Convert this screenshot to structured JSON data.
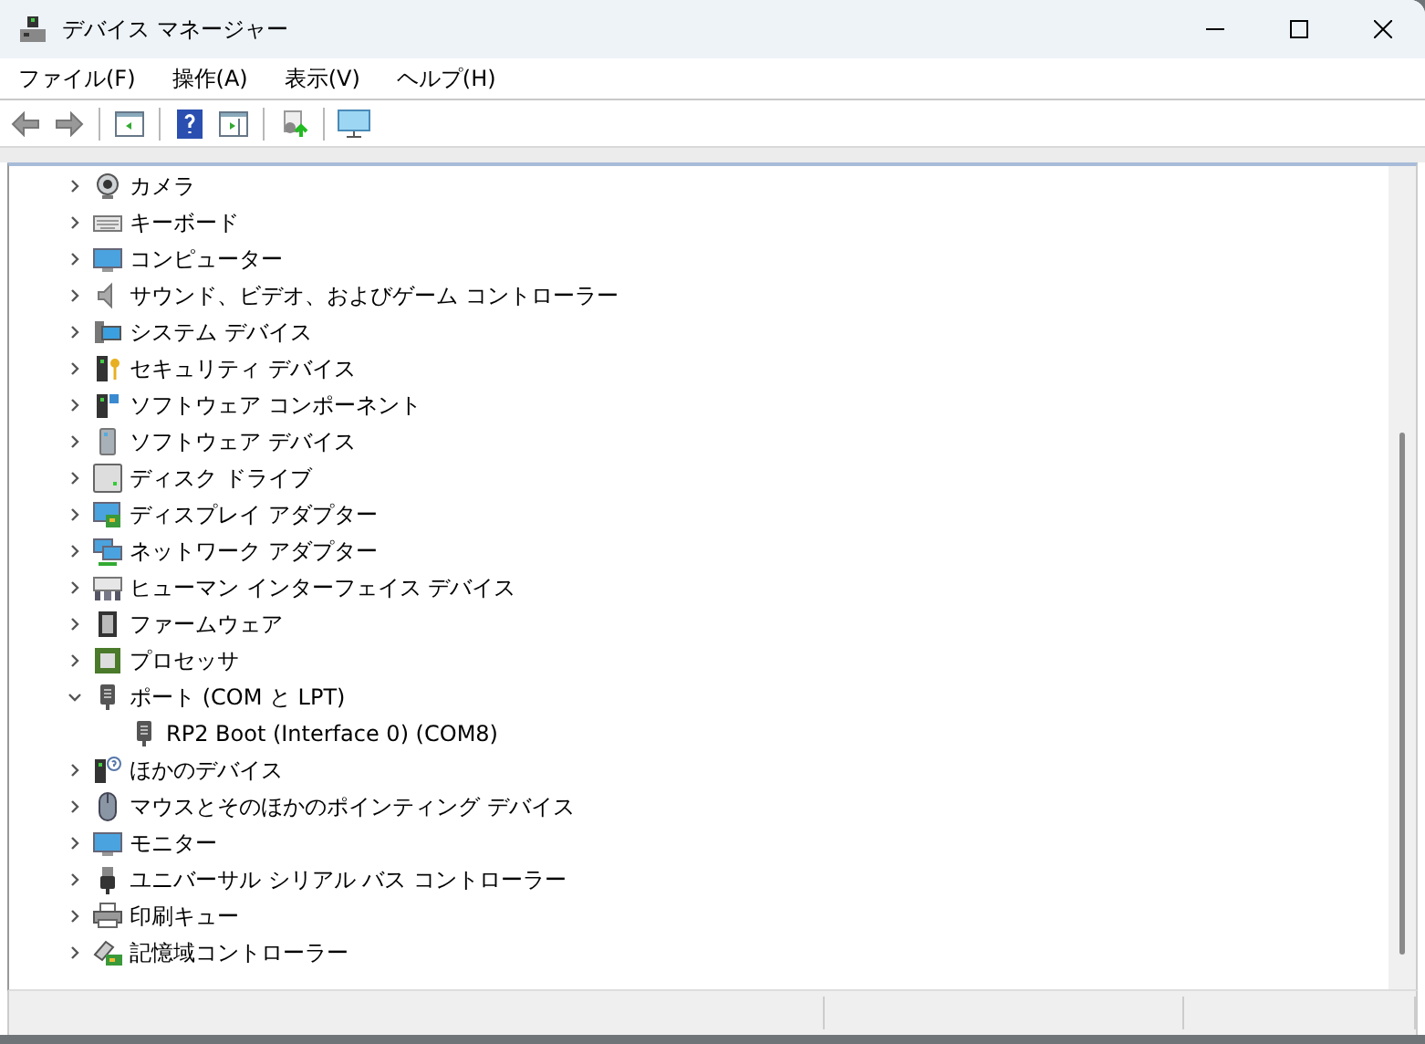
{
  "window": {
    "title": "デバイス マネージャー"
  },
  "menu": [
    {
      "label": "ファイル(F)"
    },
    {
      "label": "操作(A)"
    },
    {
      "label": "表示(V)"
    },
    {
      "label": "ヘルプ(H)"
    }
  ],
  "tree": [
    {
      "label": "カメラ",
      "expanded": false
    },
    {
      "label": "キーボード",
      "expanded": false
    },
    {
      "label": "コンピューター",
      "expanded": false
    },
    {
      "label": "サウンド、ビデオ、およびゲーム コントローラー",
      "expanded": false
    },
    {
      "label": "システム デバイス",
      "expanded": false
    },
    {
      "label": "セキュリティ デバイス",
      "expanded": false
    },
    {
      "label": "ソフトウェア コンポーネント",
      "expanded": false
    },
    {
      "label": "ソフトウェア デバイス",
      "expanded": false
    },
    {
      "label": "ディスク ドライブ",
      "expanded": false
    },
    {
      "label": "ディスプレイ アダプター",
      "expanded": false
    },
    {
      "label": "ネットワーク アダプター",
      "expanded": false
    },
    {
      "label": "ヒューマン インターフェイス デバイス",
      "expanded": false
    },
    {
      "label": "ファームウェア",
      "expanded": false
    },
    {
      "label": "プロセッサ",
      "expanded": false
    },
    {
      "label": "ポート (COM と LPT)",
      "expanded": true,
      "children": [
        {
          "label": "RP2 Boot (Interface 0) (COM8)"
        }
      ]
    },
    {
      "label": "ほかのデバイス",
      "expanded": false
    },
    {
      "label": "マウスとそのほかのポインティング デバイス",
      "expanded": false
    },
    {
      "label": "モニター",
      "expanded": false
    },
    {
      "label": "ユニバーサル シリアル バス コントローラー",
      "expanded": false
    },
    {
      "label": "印刷キュー",
      "expanded": false
    },
    {
      "label": "記憶域コントローラー",
      "expanded": false
    }
  ]
}
